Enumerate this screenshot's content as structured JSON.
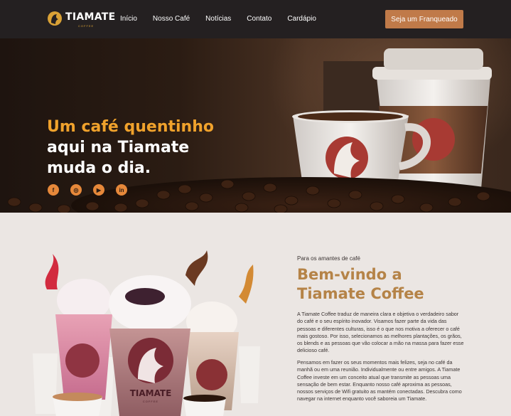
{
  "brand": {
    "name": "TIAMATE",
    "sub": "COFFEE"
  },
  "nav": {
    "items": [
      "Início",
      "Nosso Café",
      "Notícias",
      "Contato",
      "Cardápio"
    ],
    "cta": "Seja um Franqueado"
  },
  "hero": {
    "line1": "Um café quentinho",
    "line2": "aqui na Tiamate",
    "line3": "muda o dia.",
    "social": [
      "facebook",
      "instagram",
      "youtube",
      "linkedin"
    ]
  },
  "about": {
    "eyebrow": "Para os amantes de café",
    "title_line1": "Bem-vindo a",
    "title_line2": "Tiamate Coffee",
    "p1": "A Tiamate Coffee traduz de maneira clara e objetiva o verdadeiro sabor do café e o seu espírito inovador. Visamos fazer parte da vida das pessoas e diferentes culturas, isso é o que nos motiva a oferecer o café mais gostoso. Por isso, selecionamos as melhores plantações, os grãos, os blends e as pessoas que vão colocar a mão na massa para fazer esse delicioso café.",
    "p2": "Pensamos em fazer os seus momentos mais felizes, seja no café da manhã ou em uma reunião. Individualmente ou entre amigos. A Tiamate Coffee investe em um conceito atual que transmite as pessoas uma sensação de bem estar. Enquanto nosso café aproxima as pessoas, nossos serviços de Wifi gratuito as mantém conectadas. Descubra como navegar na internet enquanto você saboreia um Tiamate.",
    "cup_label": "TIAMATE",
    "cup_sub": "COFFEE"
  },
  "colors": {
    "accent": "#f0a22c",
    "cta": "#c07a49",
    "heading": "#b58347",
    "nav_bg": "#242021"
  }
}
